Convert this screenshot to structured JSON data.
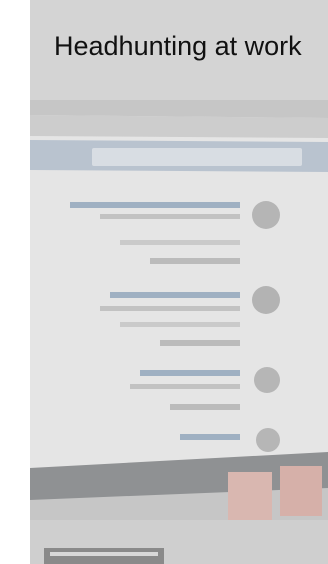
{
  "card": {
    "title": "Headhunting at work"
  }
}
